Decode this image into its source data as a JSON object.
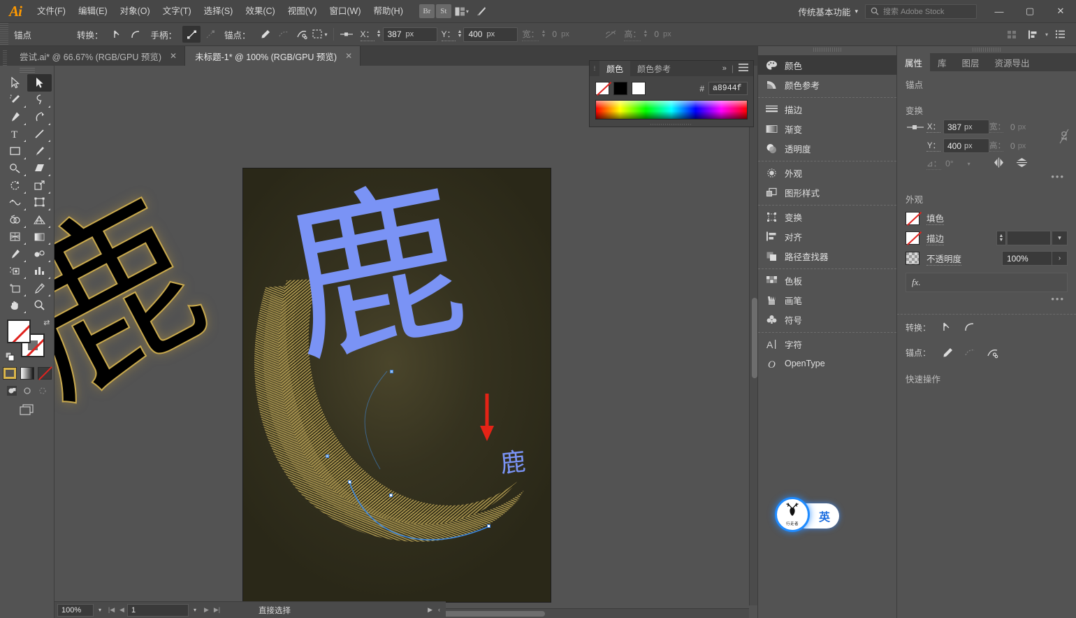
{
  "app": {
    "logo": "Ai"
  },
  "menubar": {
    "items": [
      {
        "label": "文件(F)"
      },
      {
        "label": "编辑(E)"
      },
      {
        "label": "对象(O)"
      },
      {
        "label": "文字(T)"
      },
      {
        "label": "选择(S)"
      },
      {
        "label": "效果(C)"
      },
      {
        "label": "视图(V)"
      },
      {
        "label": "窗口(W)"
      },
      {
        "label": "帮助(H)"
      }
    ],
    "bridge_label": "Br",
    "stock_label": "St",
    "arrange_icon": "arrange-documents-icon",
    "sync_icon": "sync-icon",
    "workspace": "传统基本功能",
    "workspace_chevron": "chevron-down-icon",
    "search_placeholder": "搜索 Adobe Stock",
    "search_value": "",
    "search_icon": "search-icon",
    "window_minimize": "—",
    "window_maximize": "▢",
    "window_close": "✕"
  },
  "controlbar": {
    "selection_label": "锚点",
    "convert_label": "转换：",
    "handles_label": "手柄：",
    "anchors_label": "锚点：",
    "convert_icons": [
      "convert-to-corner-icon",
      "convert-to-smooth-icon"
    ],
    "handle_icons": [
      "show-handles-icon",
      "hide-handles-icon"
    ],
    "anchor_icons": [
      "remove-anchor-icon",
      "connect-anchor-icon",
      "cut-path-icon"
    ],
    "isolate_icon": "isolate-selection-icon",
    "align_icon": "align-to-pixel-icon",
    "x_label": "X：",
    "x_value": "387",
    "x_unit": "px",
    "y_label": "Y：",
    "y_value": "400",
    "y_unit": "px",
    "w_label": "宽：",
    "w_value": "0",
    "w_unit": "px",
    "h_label": "高：",
    "h_value": "0",
    "h_unit": "px",
    "lock_icon": "lock-proportions-off-icon",
    "right_icons": [
      "transform-grid-icon",
      "align-options-icon",
      "panel-menu-icon"
    ]
  },
  "tabs": [
    {
      "label": "尝试.ai* @ 66.67% (RGB/GPU 预览)",
      "close": "✕",
      "active": false
    },
    {
      "label": "未标题-1* @ 100% (RGB/GPU 预览)",
      "close": "✕",
      "active": true
    }
  ],
  "tools": {
    "rows": [
      [
        {
          "name": "direct-selection-tool",
          "active": false
        },
        {
          "name": "selection-tool",
          "active": true
        }
      ],
      [
        {
          "name": "magic-wand-tool",
          "active": false
        },
        {
          "name": "lasso-tool",
          "active": false
        }
      ],
      [
        {
          "name": "pen-tool",
          "active": false
        },
        {
          "name": "curvature-tool",
          "active": false
        }
      ],
      [
        {
          "name": "type-tool",
          "active": false
        },
        {
          "name": "line-segment-tool",
          "active": false
        }
      ],
      [
        {
          "name": "rectangle-tool",
          "active": false
        },
        {
          "name": "paintbrush-tool",
          "active": false
        }
      ],
      [
        {
          "name": "shaper-tool",
          "active": false
        },
        {
          "name": "eraser-tool",
          "active": false
        }
      ],
      [
        {
          "name": "rotate-tool",
          "active": false
        },
        {
          "name": "scale-tool",
          "active": false
        }
      ],
      [
        {
          "name": "width-tool",
          "active": false
        },
        {
          "name": "free-transform-tool",
          "active": false
        }
      ],
      [
        {
          "name": "shape-builder-tool",
          "active": false
        },
        {
          "name": "perspective-grid-tool",
          "active": false
        }
      ],
      [
        {
          "name": "mesh-tool",
          "active": false
        },
        {
          "name": "gradient-tool",
          "active": false
        }
      ],
      [
        {
          "name": "eyedropper-tool",
          "active": false
        },
        {
          "name": "blend-tool",
          "active": false
        }
      ],
      [
        {
          "name": "symbol-sprayer-tool",
          "active": false
        },
        {
          "name": "column-graph-tool",
          "active": false
        }
      ],
      [
        {
          "name": "artboard-tool",
          "active": false
        },
        {
          "name": "slice-tool",
          "active": false
        }
      ],
      [
        {
          "name": "hand-tool",
          "active": false
        },
        {
          "name": "zoom-tool",
          "active": false
        }
      ]
    ],
    "fill_label": "fill-swatch-none",
    "stroke_label": "stroke-swatch-none",
    "swap_icon": "swap-fill-stroke-icon",
    "default_icon": "default-fill-stroke-icon",
    "color_mode": "color-mode-button",
    "gradient_mode": "gradient-mode-button",
    "none_mode": "none-mode-button",
    "draw_normal": "draw-normal-icon",
    "draw_behind": "draw-behind-icon",
    "draw_inside": "draw-inside-icon",
    "screen_mode": "change-screen-mode-icon"
  },
  "canvas": {
    "left_artwork_glyph": "鹿",
    "artboard_glyph": "鹿",
    "small_glyph": "鹿",
    "annotation_arrow": "red-down-arrow",
    "bg_color": "#2c2a1b",
    "blend_color": "#a8944f",
    "glyph_color": "#7a93f5",
    "path_color": "#3f8ae0"
  },
  "statusbar": {
    "zoom_value": "100%",
    "zoom_chevron": "chevron-down-icon",
    "first_page_icon": "first-artboard-icon",
    "prev_page_icon": "previous-artboard-icon",
    "page_value": "1",
    "page_chevron": "chevron-down-icon",
    "next_page_icon": "next-artboard-icon",
    "last_page_icon": "last-artboard-icon",
    "status_text": "直接选择",
    "status_play": "▶",
    "status_back": "‹"
  },
  "color_panel": {
    "dots_icon": "panel-drag-dots-icon",
    "tabs": [
      {
        "label": "颜色",
        "active": true
      },
      {
        "label": "颜色参考",
        "active": false
      }
    ],
    "collapse_icon": "»",
    "menu_icon": "panel-menu-icon",
    "swatch_none": "none-swatch",
    "swatch_black": "black-swatch",
    "swatch_white": "white-swatch",
    "hash_label": "#",
    "hex_value": "a8944f",
    "spectrum": "color-spectrum-ramp"
  },
  "icon_dock": {
    "groups": [
      [
        {
          "label": "颜色",
          "icon": "color-palette-icon",
          "active": true
        },
        {
          "label": "颜色参考",
          "icon": "color-guide-icon",
          "active": false
        }
      ],
      [
        {
          "label": "描边",
          "icon": "stroke-icon",
          "active": false
        },
        {
          "label": "渐变",
          "icon": "gradient-icon",
          "active": false
        },
        {
          "label": "透明度",
          "icon": "transparency-icon",
          "active": false
        }
      ],
      [
        {
          "label": "外观",
          "icon": "appearance-icon",
          "active": false
        },
        {
          "label": "图形样式",
          "icon": "graphic-styles-icon",
          "active": false
        }
      ],
      [
        {
          "label": "变换",
          "icon": "transform-icon",
          "active": false
        },
        {
          "label": "对齐",
          "icon": "align-icon",
          "active": false
        },
        {
          "label": "路径查找器",
          "icon": "pathfinder-icon",
          "active": false
        }
      ],
      [
        {
          "label": "色板",
          "icon": "swatches-icon",
          "active": false
        },
        {
          "label": "画笔",
          "icon": "brushes-icon",
          "active": false
        },
        {
          "label": "符号",
          "icon": "symbols-icon",
          "active": false
        }
      ],
      [
        {
          "label": "字符",
          "icon": "character-icon",
          "active": false
        },
        {
          "label": "OpenType",
          "icon": "opentype-icon",
          "active": false
        }
      ]
    ]
  },
  "properties": {
    "tabs": [
      {
        "label": "属性",
        "active": true
      },
      {
        "label": "库",
        "active": false
      },
      {
        "label": "图层",
        "active": false
      },
      {
        "label": "资源导出",
        "active": false
      }
    ],
    "selection_title": "锚点",
    "transform_title": "变换",
    "ref_point_icon": "reference-point-icon",
    "x_label": "X：",
    "x_value": "387",
    "x_unit": "px",
    "y_label": "Y：",
    "y_value": "400",
    "y_unit": "px",
    "w_label": "宽：",
    "w_value": "0",
    "w_unit": "px",
    "h_label": "高：",
    "h_value": "0",
    "h_unit": "px",
    "link_icon": "link-proportions-off-icon",
    "angle_label": "⊿：",
    "angle_value": "0°",
    "angle_chevron": "chevron-down-icon",
    "flip_h_icon": "flip-horizontal-icon",
    "flip_v_icon": "flip-vertical-icon",
    "more_options": "•••",
    "appearance_title": "外观",
    "fill_label": "填色",
    "stroke_label": "描边",
    "stroke_width_value": "",
    "stroke_chevron": "chevron-down-icon",
    "opacity_label": "不透明度",
    "opacity_value": "100%",
    "opacity_arrow": "›",
    "fx_label": "fx.",
    "appearance_more": "•••",
    "convert_label": "转换：",
    "convert_icons": [
      "convert-to-corner-icon",
      "convert-to-smooth-icon"
    ],
    "anchor_label": "锚点：",
    "anchor_icons": [
      "remove-anchor-icon",
      "connect-anchor-icon",
      "cut-path-icon"
    ],
    "quick_actions_title": "快速操作"
  },
  "ime": {
    "logo_glyph": "鹿",
    "logo_sub": "行走者",
    "mode_label": "英"
  }
}
